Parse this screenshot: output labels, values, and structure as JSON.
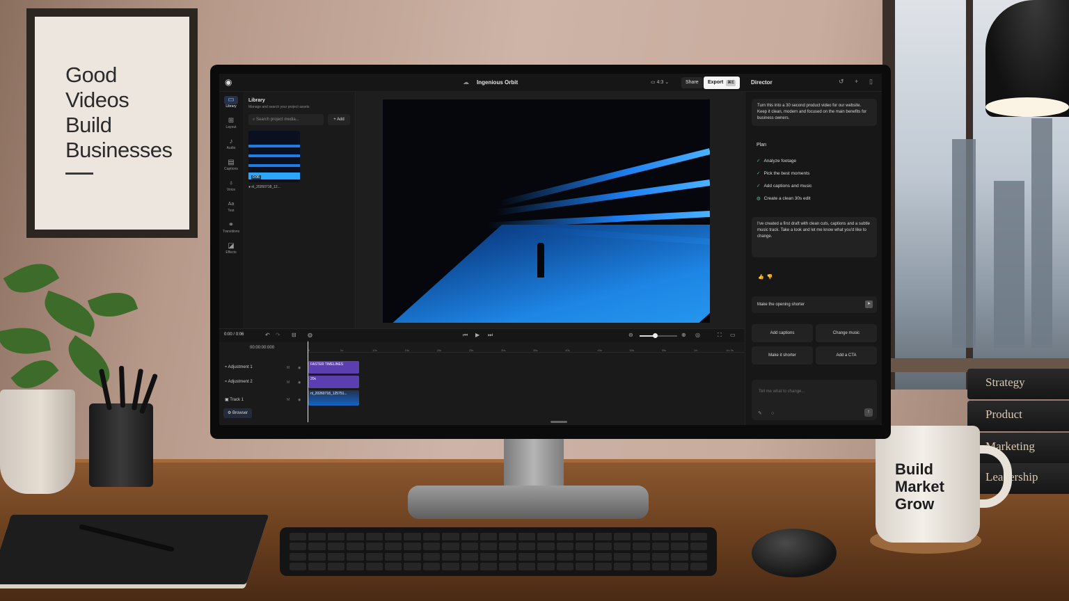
{
  "poster": {
    "lines": [
      "Good",
      "Videos",
      "Build",
      "Businesses"
    ]
  },
  "mug": {
    "lines": [
      "Build",
      "Market",
      "Grow"
    ]
  },
  "books": [
    "Strategy",
    "Product",
    "Marketing",
    "Leadership"
  ],
  "app": {
    "project_title": "Ingenious Orbit",
    "aspect_ratio": "4:3",
    "share_label": "Share",
    "export_label": "Export",
    "export_shortcut": "⌘E",
    "accent_color": "#1e7de0"
  },
  "rail": {
    "items": [
      {
        "label": "Library",
        "icon": "folder-icon"
      },
      {
        "label": "Layout",
        "icon": "grid-icon"
      },
      {
        "label": "Audio",
        "icon": "music-note-icon"
      },
      {
        "label": "Captions",
        "icon": "captions-icon"
      },
      {
        "label": "Voice",
        "icon": "microphone-icon"
      },
      {
        "label": "Text",
        "icon": "text-icon"
      },
      {
        "label": "Transitions",
        "icon": "transitions-icon"
      },
      {
        "label": "Effects",
        "icon": "effects-icon"
      }
    ]
  },
  "library": {
    "title": "Library",
    "subtitle": "Manage and search your project assets",
    "search_placeholder": "Search project media...",
    "add_label": "+ Add",
    "media": {
      "duration": "0:06",
      "filename": "nl_20260718_12..."
    }
  },
  "player": {
    "current_time": "0:00",
    "total_time": "0:06",
    "zoom_level": 0.4
  },
  "timeline": {
    "timecode": "00:00:00:000",
    "ruler_ticks": [
      "0",
      "5s",
      "10s",
      "15s",
      "20s",
      "25s",
      "30s",
      "35s",
      "40s",
      "45s",
      "50s",
      "55s",
      "1m",
      "1m 5s"
    ],
    "tracks": [
      {
        "name": "Adjustment 1",
        "m": "M",
        "clip": "FASTER TIMELINES"
      },
      {
        "name": "Adjustment 2",
        "m": "M",
        "clip": "20x"
      },
      {
        "name": "Track 1",
        "m": "M",
        "clip": "nl_20260718_125751..."
      }
    ],
    "browser_label": "Browser"
  },
  "director": {
    "title": "Director",
    "prompt": "Turn this into a 30 second product video for our website. Keep it clean, modern and focused on the main benefits for business owners.",
    "plan_title": "Plan",
    "plan_items": [
      {
        "label": "Analyze footage",
        "status": "done"
      },
      {
        "label": "Pick the best moments",
        "status": "done"
      },
      {
        "label": "Add captions and music",
        "status": "done"
      },
      {
        "label": "Create a clean 30s edit",
        "status": "in-progress"
      }
    ],
    "response": "I've created a first draft with clean cuts, captions and a subtle music track. Take a look and let me know what you'd like to change.",
    "suggestion": "Make the opening shorter",
    "chips": [
      "Add captions",
      "Change music",
      "Make it shorter",
      "Add a CTA"
    ],
    "composer_placeholder": "Tell me what to change..."
  }
}
